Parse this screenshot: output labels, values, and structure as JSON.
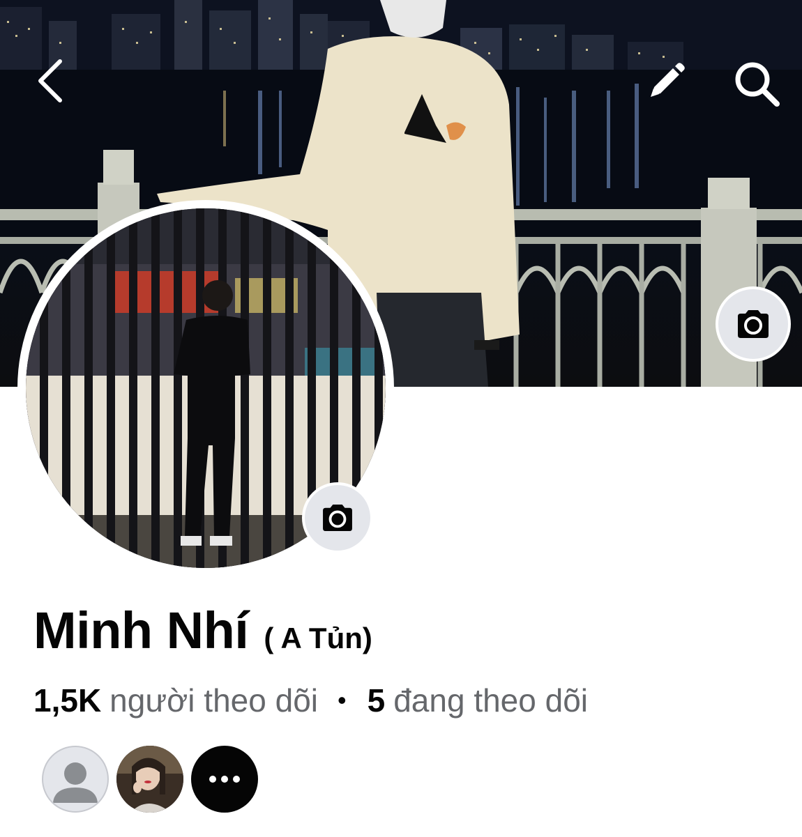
{
  "header": {
    "back_icon": "chevron-left-icon",
    "edit_icon": "pencil-icon",
    "search_icon": "search-icon"
  },
  "cover": {
    "camera_icon": "camera-icon"
  },
  "avatar": {
    "camera_icon": "camera-icon"
  },
  "profile": {
    "name": "Minh Nhí",
    "nickname": "( A Tủn)",
    "followers_count": "1,5K",
    "followers_label": "người theo dõi",
    "separator": "•",
    "following_count": "5",
    "following_label": "đang theo dõi"
  },
  "friends": {
    "items": [
      {
        "type": "default-avatar",
        "icon": "person-silhouette-icon"
      },
      {
        "type": "photo-avatar"
      },
      {
        "type": "more",
        "icon": "more-horizontal-icon"
      }
    ]
  },
  "colors": {
    "text_primary": "#050505",
    "text_secondary": "#65676b",
    "button_bg": "#e4e6eb"
  }
}
